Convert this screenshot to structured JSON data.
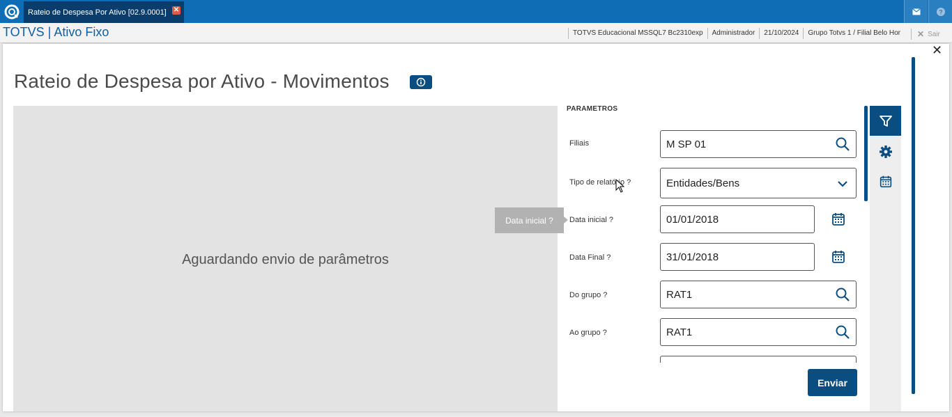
{
  "tab": {
    "title": "Rateio de Despesa Por Ativo [02.9.0001]"
  },
  "header": {
    "brand": "TOTVS | Ativo Fixo",
    "environment": "TOTVS Educacional MSSQL7 Bc2310exp",
    "user": "Administrador",
    "date": "21/10/2024",
    "branch": "Grupo Totvs 1 / Filial Belo Hor",
    "logout_label": "Sair"
  },
  "page": {
    "title": "Rateio de Despesa por Ativo - Movimentos",
    "waiting_message": "Aguardando envio de parâmetros"
  },
  "params": {
    "section_title": "PARAMETROS",
    "fields": [
      {
        "label": "Filiais",
        "value": "M SP 01",
        "icon": "search-icon"
      },
      {
        "label": "Tipo de relatório ?",
        "value": "Entidades/Bens",
        "icon": "chevron-down-icon"
      },
      {
        "label": "Data inicial ?",
        "value": "01/01/2018",
        "icon": "calendar-icon"
      },
      {
        "label": "Data Final ?",
        "value": "31/01/2018",
        "icon": "calendar-icon"
      },
      {
        "label": "Do grupo ?",
        "value": "RAT1",
        "icon": "search-icon"
      },
      {
        "label": "Ao grupo ?",
        "value": "RAT1",
        "icon": "search-icon"
      }
    ],
    "submit_label": "Enviar"
  },
  "tooltip": {
    "text": "Data inicial ?"
  },
  "side_rail": [
    "filter-icon",
    "gear-icon",
    "calendar-icon"
  ],
  "colors": {
    "topbar": "#0e6db5",
    "primary": "#0a4d80",
    "left_area": "#e3e3e3"
  }
}
